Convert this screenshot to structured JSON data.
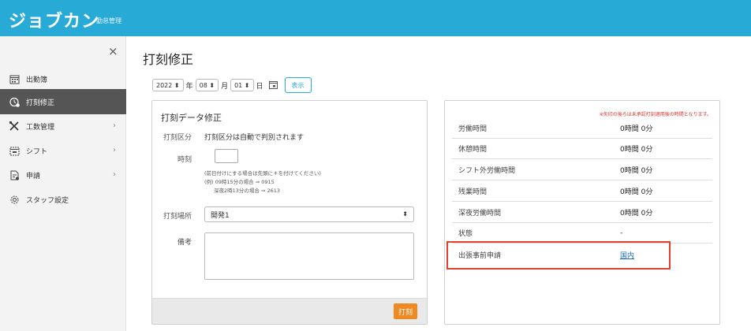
{
  "header": {
    "logo": "ジョブカン",
    "logo_sub": "勤怠管理",
    "bg_color": "#27abd6"
  },
  "sidebar": {
    "close": "×",
    "items": [
      {
        "label": "出勤簿",
        "icon": "calendar-grid-icon"
      },
      {
        "label": "打刻修正",
        "icon": "clock-edit-icon",
        "active": true
      },
      {
        "label": "工数管理",
        "icon": "tools-icon"
      },
      {
        "label": "シフト",
        "icon": "calendar-icon"
      },
      {
        "label": "申請",
        "icon": "document-icon"
      },
      {
        "label": "スタッフ設定",
        "icon": "gear-icon"
      }
    ]
  },
  "page": {
    "title": "打刻修正"
  },
  "datebar": {
    "year": "2022",
    "year_unit": "年",
    "month": "08",
    "month_unit": "月",
    "day": "01",
    "day_unit": "日",
    "show_button": "表示"
  },
  "form": {
    "title": "打刻データ修正",
    "stamp_type_label": "打刻区分",
    "stamp_type_value": "打刻区分は自動で判別されます",
    "time_label": "時刻",
    "time_value": "",
    "hint1": "(前日付けにする場合は先頭に＊を付けてください)",
    "hint2": "(例) 09時15分の場合 ⇒ 0915",
    "hint3": "深夜2時13分の場合 ⇒ 2613",
    "place_label": "打刻場所",
    "place_value": "開発1",
    "memo_label": "備考",
    "memo_value": "",
    "submit": "打刻"
  },
  "summary": {
    "note": "※矢印の後ろは未承認打刻適用後の時間となります。",
    "rows": [
      {
        "label": "労働時間",
        "value": "0時間 0分"
      },
      {
        "label": "休憩時間",
        "value": "0時間 0分"
      },
      {
        "label": "シフト外労働時間",
        "value": "0時間 0分"
      },
      {
        "label": "残業時間",
        "value": "0時間 0分"
      },
      {
        "label": "深夜労働時間",
        "value": "0時間 0分"
      },
      {
        "label": "状態",
        "value": "-"
      },
      {
        "label": "出張事前申請",
        "value": "国内"
      }
    ],
    "highlight_color": "#e0412c",
    "accent_color": "#ef8a22"
  }
}
